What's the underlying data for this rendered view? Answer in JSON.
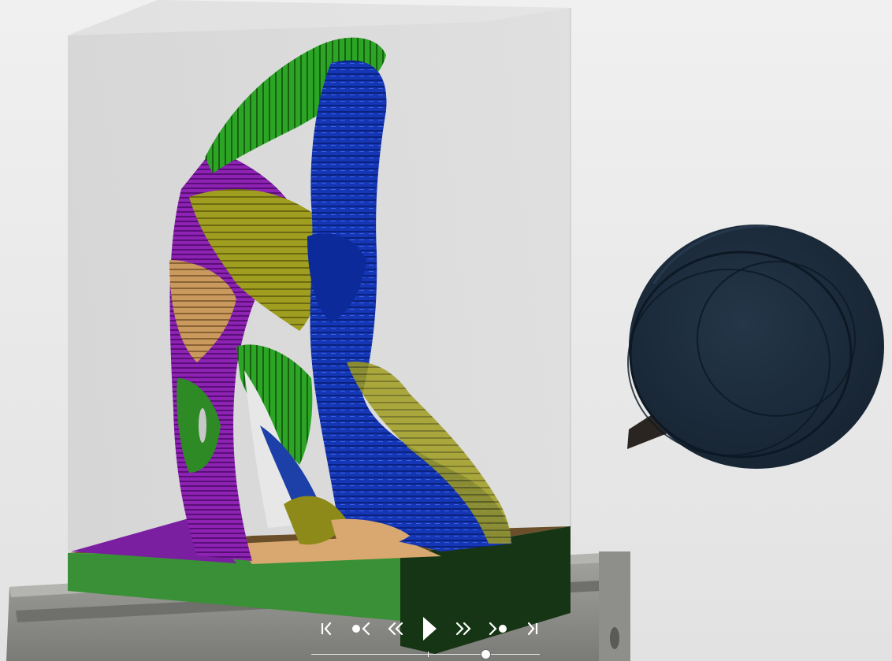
{
  "viewport": {
    "background": "#ebebeb"
  },
  "colors": {
    "stock_glass": "#d9d9d9",
    "base_green": "#3a8f36",
    "base_dark_green": "#163514",
    "blue": "#1235b8",
    "purple": "#8a1fb0",
    "olive": "#9c9a1e",
    "tan": "#c4975e",
    "green": "#2a9a23",
    "tool_body": "#1c2b3a",
    "vise": "#8a8a86"
  },
  "playback": {
    "controls": [
      {
        "name": "go-to-start-button",
        "icon": "skip-to-start-icon"
      },
      {
        "name": "previous-operation-button",
        "icon": "previous-point-icon"
      },
      {
        "name": "step-back-button",
        "icon": "double-chevron-left-icon"
      },
      {
        "name": "play-button",
        "icon": "play-icon"
      },
      {
        "name": "step-forward-button",
        "icon": "double-chevron-right-icon"
      },
      {
        "name": "next-operation-button",
        "icon": "next-point-icon"
      },
      {
        "name": "go-to-end-button",
        "icon": "skip-to-end-icon"
      }
    ],
    "progress": 0.76
  }
}
